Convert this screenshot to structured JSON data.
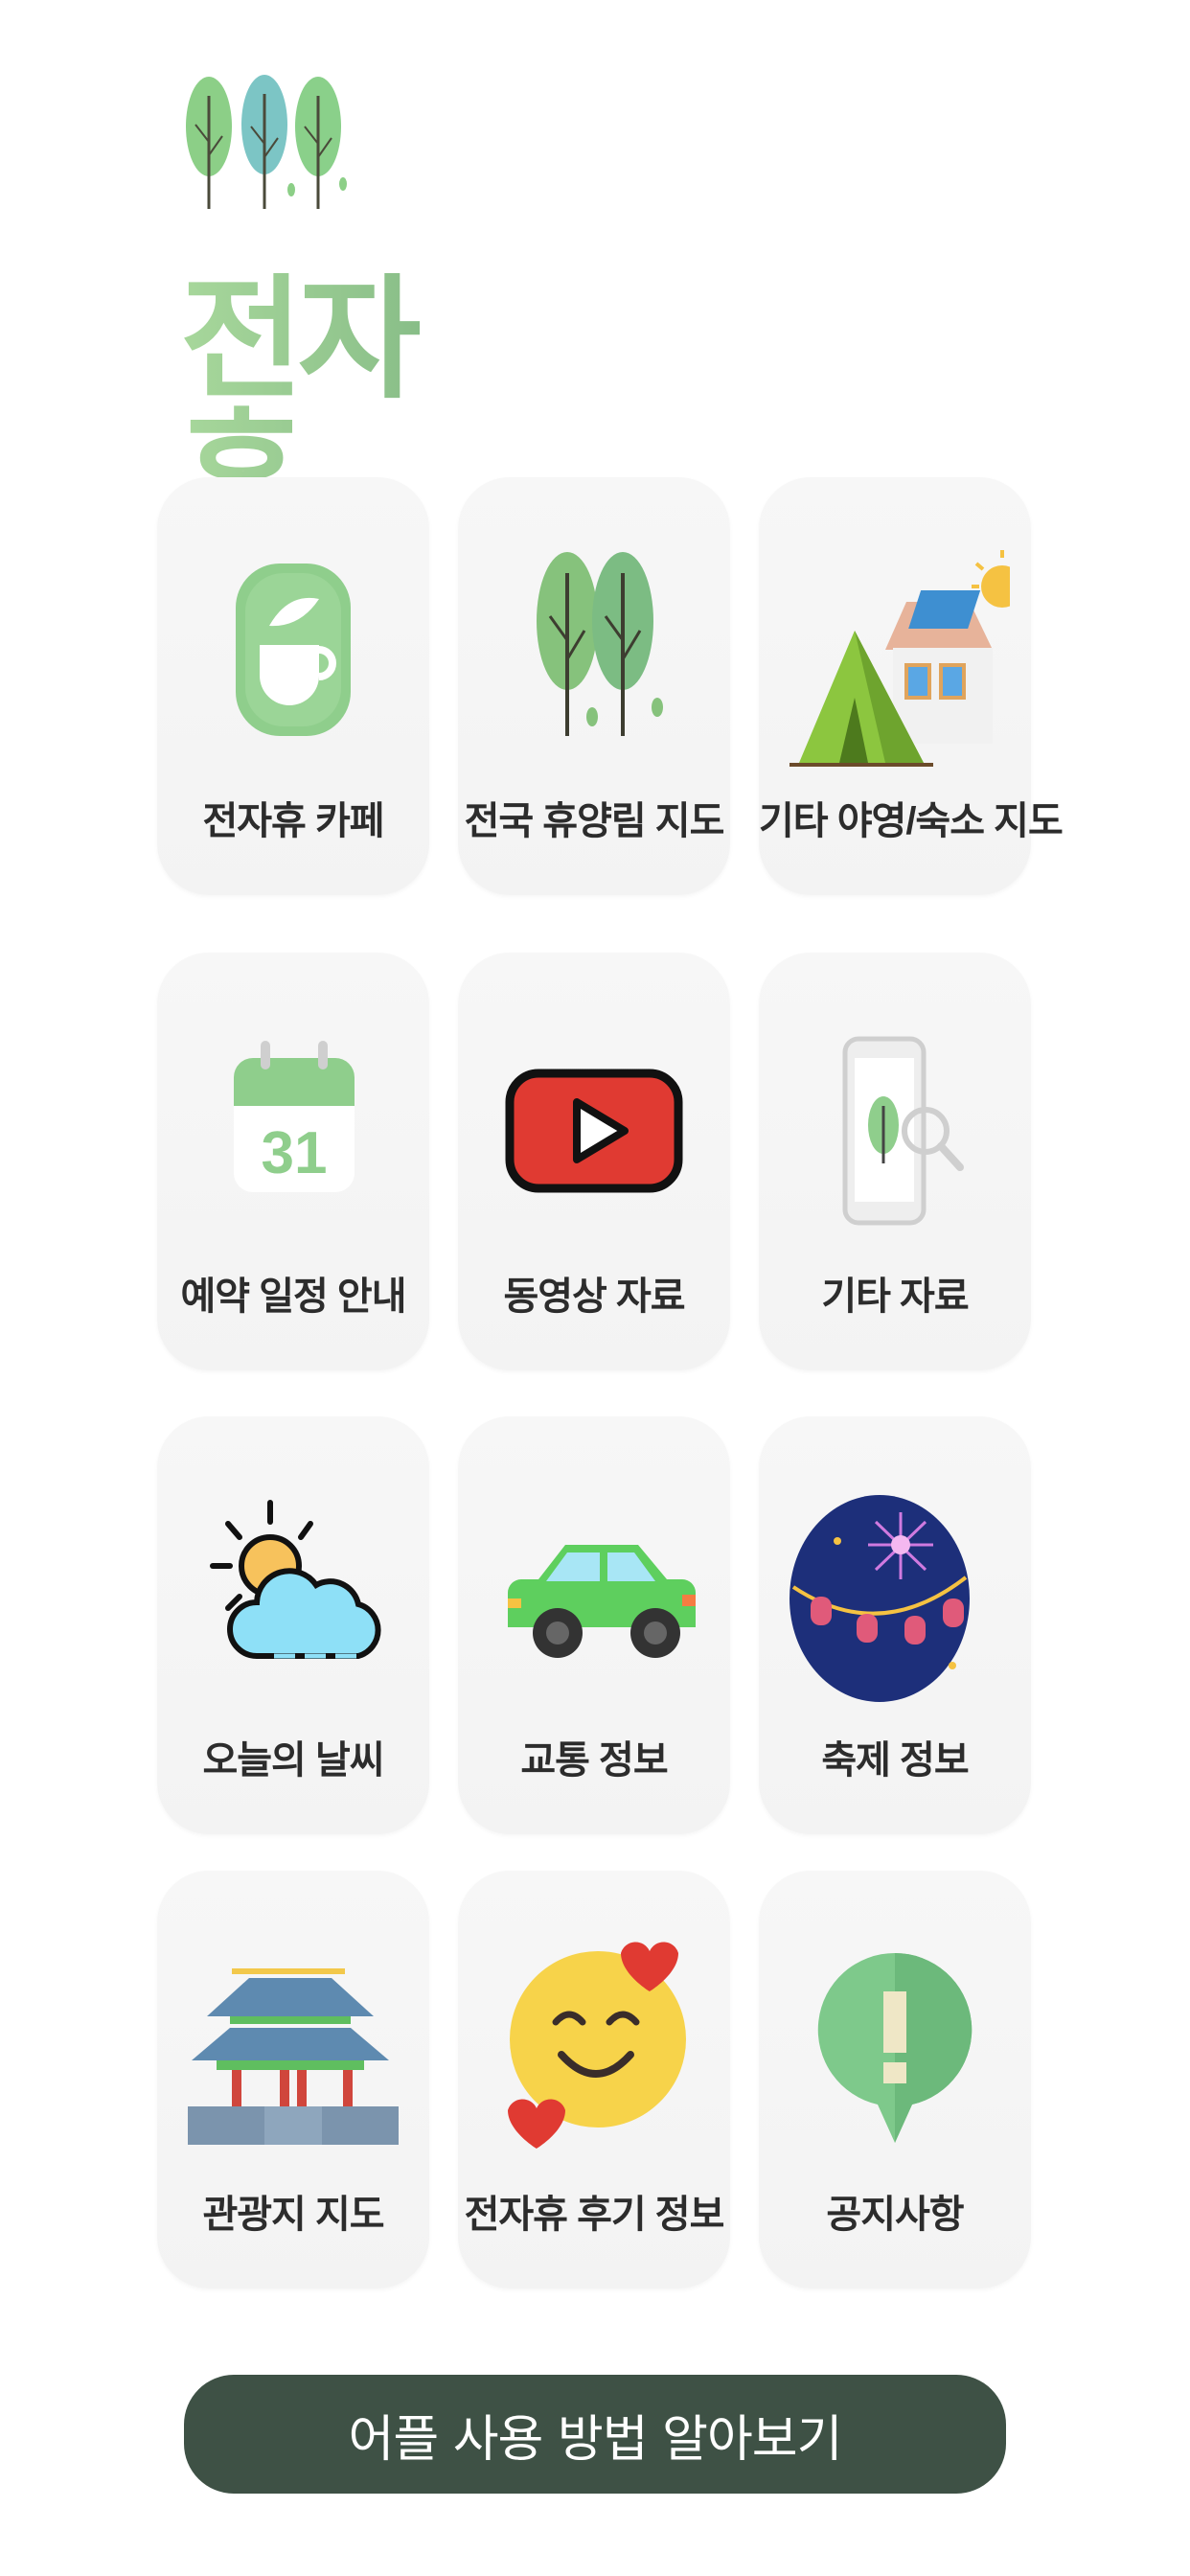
{
  "app": {
    "title": "전자휴"
  },
  "menu": [
    {
      "label": "전자휴 카페",
      "icon": "cafe-cup-icon"
    },
    {
      "label": "전국 휴양림 지도",
      "icon": "forest-trees-icon"
    },
    {
      "label": "기타 야영/숙소 지도",
      "icon": "tent-house-icon"
    },
    {
      "label": "예약 일정 안내",
      "icon": "calendar-icon",
      "icon_text": "31"
    },
    {
      "label": "동영상 자료",
      "icon": "video-play-icon"
    },
    {
      "label": "기타 자료",
      "icon": "phone-search-icon"
    },
    {
      "label": "오늘의 날씨",
      "icon": "weather-sun-cloud-icon"
    },
    {
      "label": "교통 정보",
      "icon": "car-icon"
    },
    {
      "label": "축제 정보",
      "icon": "festival-lanterns-icon"
    },
    {
      "label": "관광지 지도",
      "icon": "palace-icon"
    },
    {
      "label": "전자휴 후기 정보",
      "icon": "smile-hearts-icon"
    },
    {
      "label": "공지사항",
      "icon": "notice-exclamation-icon"
    }
  ],
  "cta": {
    "label": "어플 사용 방법 알아보기"
  },
  "colors": {
    "brand_green": "#8fc38c",
    "button_dark": "#3e5145"
  }
}
